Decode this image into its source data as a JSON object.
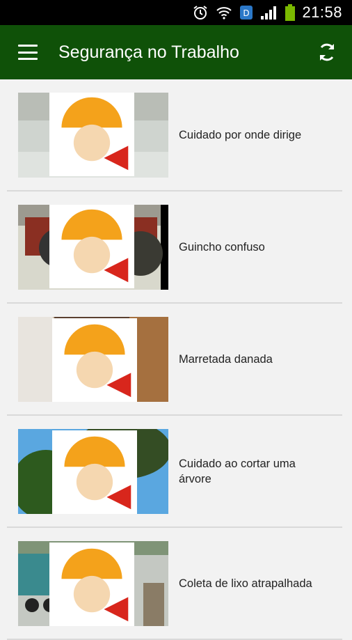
{
  "status_bar": {
    "time": "21:58"
  },
  "app_bar": {
    "title": "Segurança no Trabalho"
  },
  "videos": [
    {
      "title": "Cuidado por onde dirige"
    },
    {
      "title": "Guincho confuso"
    },
    {
      "title": "Marretada danada"
    },
    {
      "title": "Cuidado ao cortar uma árvore"
    },
    {
      "title": "Coleta de lixo atrapalhada"
    }
  ],
  "colors": {
    "app_bar": "#0f5108",
    "status_bar": "#000000",
    "background": "#f2f2f2"
  }
}
